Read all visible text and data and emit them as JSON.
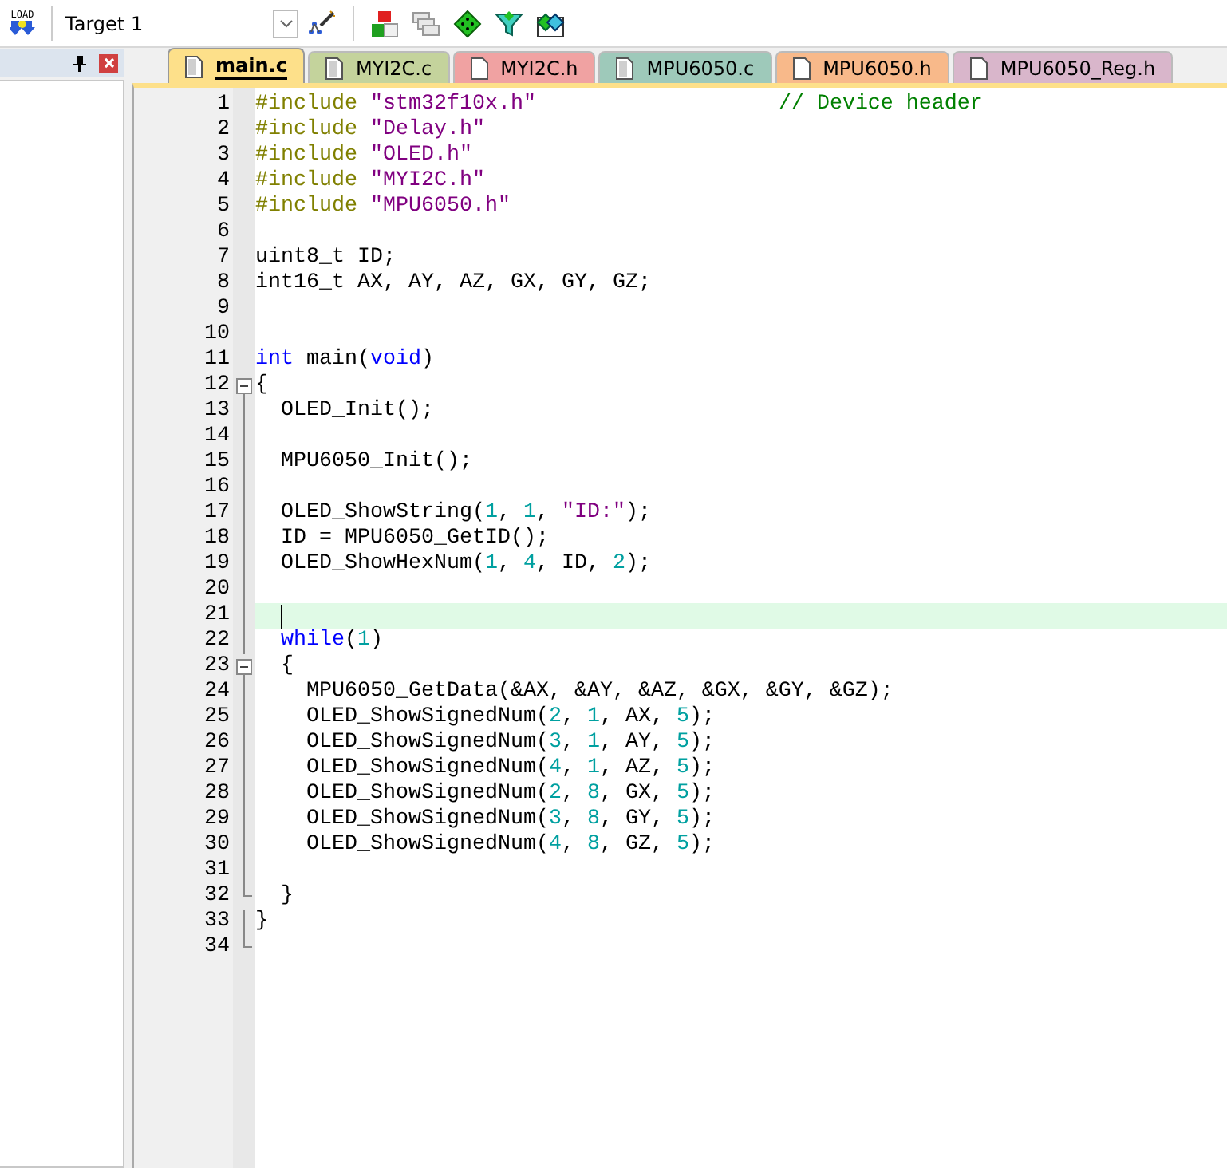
{
  "toolbar": {
    "load_label": "LOAD",
    "target": "Target 1"
  },
  "tabs": [
    {
      "label": "main.c",
      "selected": true,
      "kind": "source",
      "color": "#fde08a"
    },
    {
      "label": "MYI2C.c",
      "selected": false,
      "kind": "source",
      "color": "#c4d39c"
    },
    {
      "label": "MYI2C.h",
      "selected": false,
      "kind": "header",
      "color": "#f0a2a2"
    },
    {
      "label": "MPU6050.c",
      "selected": false,
      "kind": "source",
      "color": "#9ec9ba"
    },
    {
      "label": "MPU6050.h",
      "selected": false,
      "kind": "header",
      "color": "#f8b98a"
    },
    {
      "label": "MPU6050_Reg.h",
      "selected": false,
      "kind": "header",
      "color": "#d9b6cb"
    }
  ],
  "lines": [
    {
      "number": "1",
      "kind": "plain",
      "tokens": [
        {
          "kind": "pp",
          "text": "#include"
        },
        {
          "kind": "str",
          "text": " \"stm32f10x.h\""
        },
        {
          "kind": "cm",
          "text": "                   // Device header"
        }
      ]
    },
    {
      "number": "2",
      "kind": "plain",
      "tokens": [
        {
          "kind": "pp",
          "text": "#include"
        },
        {
          "kind": "str",
          "text": " \"Delay.h\""
        }
      ]
    },
    {
      "number": "3",
      "kind": "plain",
      "tokens": [
        {
          "kind": "pp",
          "text": "#include"
        },
        {
          "kind": "str",
          "text": " \"OLED.h\""
        }
      ]
    },
    {
      "number": "4",
      "kind": "plain",
      "tokens": [
        {
          "kind": "pp",
          "text": "#include"
        },
        {
          "kind": "str",
          "text": " \"MYI2C.h\""
        }
      ]
    },
    {
      "number": "5",
      "kind": "plain",
      "tokens": [
        {
          "kind": "pp",
          "text": "#include"
        },
        {
          "kind": "str",
          "text": " \"MPU6050.h\""
        }
      ]
    },
    {
      "number": "6",
      "kind": "plain"
    },
    {
      "number": "7",
      "kind": "plain",
      "tokens": [
        {
          "kind": "tx",
          "text": "uint8_t ID;"
        }
      ]
    },
    {
      "number": "8",
      "kind": "plain",
      "tokens": [
        {
          "kind": "tx",
          "text": "int16_t AX, AY, AZ, GX, GY, GZ;"
        }
      ]
    },
    {
      "number": "9",
      "kind": "plain"
    },
    {
      "number": "10",
      "kind": "plain"
    },
    {
      "number": "11",
      "kind": "plain",
      "tokens": [
        {
          "kind": "kw",
          "text": "int"
        },
        {
          "kind": "tx",
          "text": " main("
        },
        {
          "kind": "kw",
          "text": "void"
        },
        {
          "kind": "tx",
          "text": ")"
        }
      ]
    },
    {
      "number": "12",
      "kind": "open",
      "tokens": [
        {
          "kind": "tx",
          "text": "{"
        }
      ]
    },
    {
      "number": "13",
      "kind": "line",
      "tokens": [
        {
          "kind": "tx",
          "text": "  OLED_Init();"
        }
      ]
    },
    {
      "number": "14",
      "kind": "line"
    },
    {
      "number": "15",
      "kind": "line",
      "tokens": [
        {
          "kind": "tx",
          "text": "  MPU6050_Init();"
        }
      ]
    },
    {
      "number": "16",
      "kind": "line"
    },
    {
      "number": "17",
      "kind": "line",
      "tokens": [
        {
          "kind": "tx",
          "text": "  OLED_ShowString("
        },
        {
          "kind": "num",
          "text": "1"
        },
        {
          "kind": "tx",
          "text": ", "
        },
        {
          "kind": "num",
          "text": "1"
        },
        {
          "kind": "tx",
          "text": ", "
        },
        {
          "kind": "str",
          "text": "\"ID:\""
        },
        {
          "kind": "tx",
          "text": ");"
        }
      ]
    },
    {
      "number": "18",
      "kind": "line",
      "tokens": [
        {
          "kind": "tx",
          "text": "  ID = MPU6050_GetID();"
        }
      ]
    },
    {
      "number": "19",
      "kind": "line",
      "tokens": [
        {
          "kind": "tx",
          "text": "  OLED_ShowHexNum("
        },
        {
          "kind": "num",
          "text": "1"
        },
        {
          "kind": "tx",
          "text": ", "
        },
        {
          "kind": "num",
          "text": "4"
        },
        {
          "kind": "tx",
          "text": ", ID, "
        },
        {
          "kind": "num",
          "text": "2"
        },
        {
          "kind": "tx",
          "text": ");"
        }
      ]
    },
    {
      "number": "20",
      "kind": "line"
    },
    {
      "number": "21",
      "kind": "line",
      "current": true
    },
    {
      "number": "22",
      "kind": "line",
      "tokens": [
        {
          "kind": "kw",
          "text": "  while"
        },
        {
          "kind": "tx",
          "text": "("
        },
        {
          "kind": "num",
          "text": "1"
        },
        {
          "kind": "tx",
          "text": ")"
        }
      ]
    },
    {
      "number": "23",
      "kind": "open",
      "tokens": [
        {
          "kind": "tx",
          "text": "  {"
        }
      ]
    },
    {
      "number": "24",
      "kind": "line",
      "tokens": [
        {
          "kind": "tx",
          "text": "    MPU6050_GetData(&AX, &AY, &AZ, &GX, &GY, &GZ);"
        }
      ]
    },
    {
      "number": "25",
      "kind": "line",
      "tokens": [
        {
          "kind": "tx",
          "text": "    OLED_ShowSignedNum("
        },
        {
          "kind": "num",
          "text": "2"
        },
        {
          "kind": "tx",
          "text": ", "
        },
        {
          "kind": "num",
          "text": "1"
        },
        {
          "kind": "tx",
          "text": ", AX, "
        },
        {
          "kind": "num",
          "text": "5"
        },
        {
          "kind": "tx",
          "text": ");"
        }
      ]
    },
    {
      "number": "26",
      "kind": "line",
      "tokens": [
        {
          "kind": "tx",
          "text": "    OLED_ShowSignedNum("
        },
        {
          "kind": "num",
          "text": "3"
        },
        {
          "kind": "tx",
          "text": ", "
        },
        {
          "kind": "num",
          "text": "1"
        },
        {
          "kind": "tx",
          "text": ", AY, "
        },
        {
          "kind": "num",
          "text": "5"
        },
        {
          "kind": "tx",
          "text": ");"
        }
      ]
    },
    {
      "number": "27",
      "kind": "line",
      "tokens": [
        {
          "kind": "tx",
          "text": "    OLED_ShowSignedNum("
        },
        {
          "kind": "num",
          "text": "4"
        },
        {
          "kind": "tx",
          "text": ", "
        },
        {
          "kind": "num",
          "text": "1"
        },
        {
          "kind": "tx",
          "text": ", AZ, "
        },
        {
          "kind": "num",
          "text": "5"
        },
        {
          "kind": "tx",
          "text": ");"
        }
      ]
    },
    {
      "number": "28",
      "kind": "line",
      "tokens": [
        {
          "kind": "tx",
          "text": "    OLED_ShowSignedNum("
        },
        {
          "kind": "num",
          "text": "2"
        },
        {
          "kind": "tx",
          "text": ", "
        },
        {
          "kind": "num",
          "text": "8"
        },
        {
          "kind": "tx",
          "text": ", GX, "
        },
        {
          "kind": "num",
          "text": "5"
        },
        {
          "kind": "tx",
          "text": ");"
        }
      ]
    },
    {
      "number": "29",
      "kind": "line",
      "tokens": [
        {
          "kind": "tx",
          "text": "    OLED_ShowSignedNum("
        },
        {
          "kind": "num",
          "text": "3"
        },
        {
          "kind": "tx",
          "text": ", "
        },
        {
          "kind": "num",
          "text": "8"
        },
        {
          "kind": "tx",
          "text": ", GY, "
        },
        {
          "kind": "num",
          "text": "5"
        },
        {
          "kind": "tx",
          "text": ");"
        }
      ]
    },
    {
      "number": "30",
      "kind": "line",
      "tokens": [
        {
          "kind": "tx",
          "text": "    OLED_ShowSignedNum("
        },
        {
          "kind": "num",
          "text": "4"
        },
        {
          "kind": "tx",
          "text": ", "
        },
        {
          "kind": "num",
          "text": "8"
        },
        {
          "kind": "tx",
          "text": ", GZ, "
        },
        {
          "kind": "num",
          "text": "5"
        },
        {
          "kind": "tx",
          "text": ");"
        }
      ]
    },
    {
      "number": "31",
      "kind": "line"
    },
    {
      "number": "32",
      "kind": "end",
      "tokens": [
        {
          "kind": "tx",
          "text": "  }"
        }
      ]
    },
    {
      "number": "33",
      "kind": "line",
      "tokens": [
        {
          "kind": "tx",
          "text": "}"
        }
      ]
    },
    {
      "number": "34",
      "kind": "end"
    }
  ]
}
